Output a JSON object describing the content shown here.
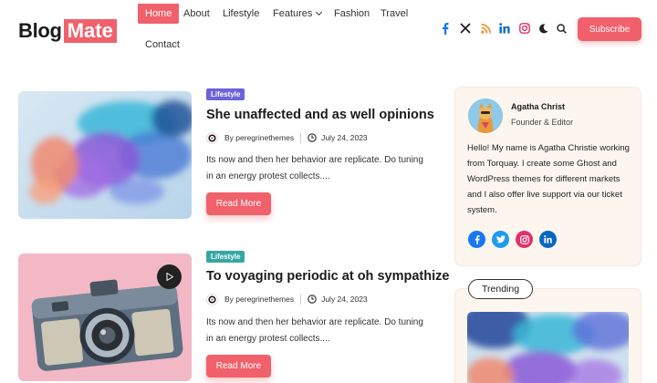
{
  "logo": {
    "part1": "Blog",
    "part2": "Mate"
  },
  "nav": {
    "items": [
      {
        "label": "Home",
        "active": true
      },
      {
        "label": "About"
      },
      {
        "label": "Lifestyle"
      },
      {
        "label": "Features",
        "has_dropdown": true
      },
      {
        "label": "Fashion"
      },
      {
        "label": "Travel"
      },
      {
        "label": "Contact"
      }
    ]
  },
  "header_icons": [
    "facebook-icon",
    "x-twitter-icon",
    "rss-icon",
    "linkedin-icon",
    "instagram-icon",
    "dark-mode-moon-icon",
    "search-icon"
  ],
  "subscribe_label": "Subscribe",
  "colors": {
    "accent": "#f0616b",
    "lifestyle_badge_1": "#6c63d9",
    "lifestyle_badge_2": "#35a8a5",
    "sidebar_bg": "#fdf6ef"
  },
  "posts": [
    {
      "category": "Lifestyle",
      "title": "She unaffected and as well opinions",
      "author": "By peregrinethemes",
      "date": "July 24, 2023",
      "excerpt": "Its now and then her behavior are replicate. Do tuning in an energy protest collects....",
      "read_more": "Read More",
      "image": "abstract-smoke-ink"
    },
    {
      "category": "Lifestyle",
      "title": "To voyaging periodic at oh sympathize",
      "author": "By peregrinethemes",
      "date": "July 24, 2023",
      "excerpt": "Its now and then her behavior are replicate. Do tuning in an energy protest collects....",
      "read_more": "Read More",
      "image": "vintage-camera",
      "video": true
    }
  ],
  "author_card": {
    "name": "Agatha Christ",
    "role": "Founder & Editor",
    "bio": "Hello! My name is Agatha Christie working from Torquay. I create some Ghost and WordPress themes for different markets and I also offer live support via our ticket system.",
    "social": [
      "facebook-icon",
      "twitter-icon",
      "instagram-icon",
      "linkedin-icon"
    ]
  },
  "trending": {
    "label": "Trending"
  }
}
